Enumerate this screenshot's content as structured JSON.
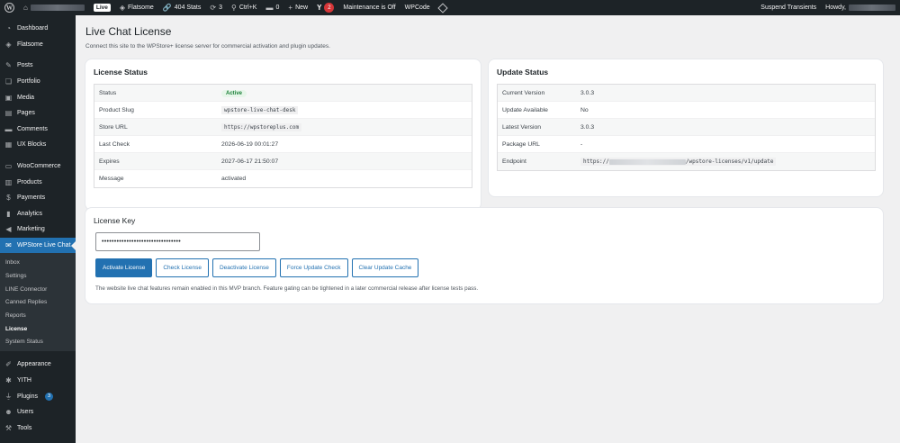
{
  "adminbar": {
    "live_label": "Live",
    "site_label": "Flatsome",
    "stats_label": "404 Stats",
    "updates_count": "3",
    "search_label": "Ctrl+K",
    "comments_count": "0",
    "new_label": "New",
    "yoast_count": "2",
    "maintenance_label": "Maintenance is Off",
    "wpcode_label": "WPCode",
    "suspend_label": "Suspend Transients",
    "howdy_label": "Howdy,"
  },
  "sidebar": {
    "items": [
      {
        "label": "Dashboard",
        "icon": "dashboard-icon"
      },
      {
        "label": "Flatsome",
        "icon": "flatsome-icon"
      },
      {
        "label": "Posts",
        "icon": "pin-icon"
      },
      {
        "label": "Portfolio",
        "icon": "portfolio-icon"
      },
      {
        "label": "Media",
        "icon": "media-icon"
      },
      {
        "label": "Pages",
        "icon": "pages-icon"
      },
      {
        "label": "Comments",
        "icon": "comment-icon"
      },
      {
        "label": "UX Blocks",
        "icon": "blocks-icon"
      },
      {
        "label": "WooCommerce",
        "icon": "woo-icon"
      },
      {
        "label": "Products",
        "icon": "box-icon"
      },
      {
        "label": "Payments",
        "icon": "payments-icon"
      },
      {
        "label": "Analytics",
        "icon": "chart-icon"
      },
      {
        "label": "Marketing",
        "icon": "megaphone-icon"
      },
      {
        "label": "WPStore Live Chat",
        "icon": "chat-icon"
      },
      {
        "label": "Appearance",
        "icon": "brush-icon"
      },
      {
        "label": "YITH",
        "icon": "yith-icon"
      },
      {
        "label": "Plugins",
        "icon": "plug-icon",
        "badge": "3"
      },
      {
        "label": "Users",
        "icon": "users-icon"
      },
      {
        "label": "Tools",
        "icon": "wrench-icon"
      }
    ],
    "submenu": [
      "Inbox",
      "Settings",
      "LINE Connector",
      "Canned Replies",
      "Reports",
      "License",
      "System Status"
    ]
  },
  "page": {
    "title": "Live Chat License",
    "description": "Connect this site to the WPStore+ license server for commercial activation and plugin updates."
  },
  "license_status": {
    "title": "License Status",
    "rows": [
      {
        "key": "Status",
        "value": "Active"
      },
      {
        "key": "Product Slug",
        "value": "wpstore-live-chat-desk"
      },
      {
        "key": "Store URL",
        "value": "https://wpstoreplus.com"
      },
      {
        "key": "Last Check",
        "value": "2026-06-19 00:01:27"
      },
      {
        "key": "Expires",
        "value": "2027-06-17 21:50:07"
      },
      {
        "key": "Message",
        "value": "activated"
      }
    ]
  },
  "update_status": {
    "title": "Update Status",
    "rows": [
      {
        "key": "Current Version",
        "value": "3.0.3"
      },
      {
        "key": "Update Available",
        "value": "No"
      },
      {
        "key": "Latest Version",
        "value": "3.0.3"
      },
      {
        "key": "Package URL",
        "value": "-"
      },
      {
        "key": "Endpoint",
        "value_prefix": "https://",
        "value_suffix": "/wpstore-licenses/v1/update"
      }
    ]
  },
  "license_key": {
    "title": "License Key",
    "value": "••••••••••••••••••••••••••••••••",
    "buttons": {
      "activate": "Activate License",
      "check": "Check License",
      "deactivate": "Deactivate License",
      "force": "Force Update Check",
      "clear": "Clear Update Cache"
    },
    "note": "The website live chat features remain enabled in this MVP branch. Feature gating can be tightened in a later commercial release after license tests pass."
  }
}
